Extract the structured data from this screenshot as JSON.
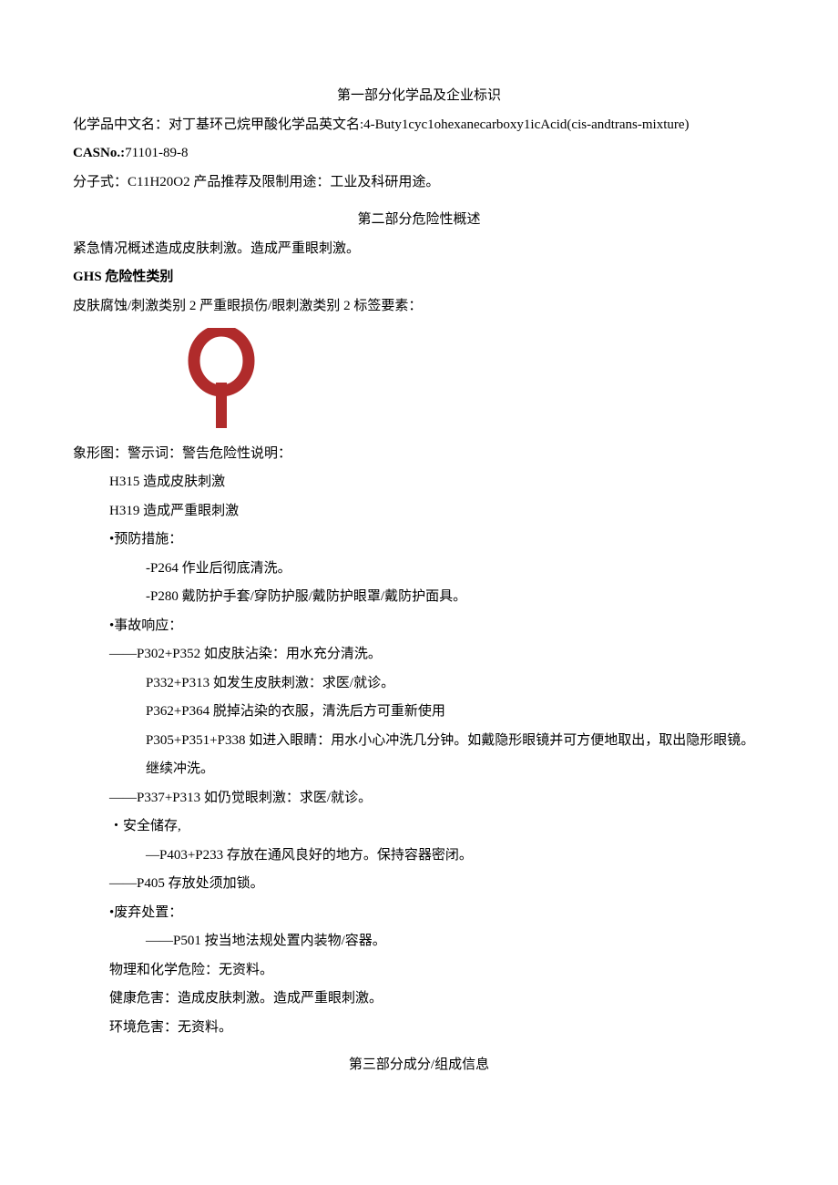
{
  "section1": {
    "title": "第一部分化学品及企业标识",
    "name_line": "化学品中文名：对丁基环己烷甲酸化学品英文名:4-Buty1cyc1ohexanecarboxy1icAcid(cis-andtrans-mixture)",
    "cas_label": "CASNo.:",
    "cas_value": "71101-89-8",
    "formula_line": "分子式：C11H20O2 产品推荐及限制用途：工业及科研用途。"
  },
  "section2": {
    "title": "第二部分危险性概述",
    "emergency": "紧急情况概述造成皮肤刺激。造成严重眼刺激。",
    "ghs_label": "GHS 危险性类别",
    "ghs_cat": "皮肤腐蚀/刺激类别 2 严重眼损伤/眼刺激类别 2 标签要素：",
    "picto_line": "象形图：警示词：警告危险性说明：",
    "h315": "H315 造成皮肤刺激",
    "h319": "H319 造成严重眼刺激",
    "precaution_label": "•预防措施：",
    "p264": "-P264 作业后彻底清洗。",
    "p280": "-P280 戴防护手套/穿防护服/戴防护眼罩/戴防护面具。",
    "response_label": "•事故响应：",
    "p302": "——P302+P352 如皮肤沾染：用水充分清洗。",
    "p332": "P332+P313 如发生皮肤刺激：求医/就诊。",
    "p362": "P362+P364 脱掉沾染的衣服，清洗后方可重新使用",
    "p305": "P305+P351+P338 如进入眼睛：用水小心冲洗几分钟。如戴隐形眼镜并可方便地取出，取出隐形眼镜。继续冲洗。",
    "p337": "——P337+P313 如仍觉眼刺激：求医/就诊。",
    "storage_label": "・安全储存,",
    "p403": "—P403+P233 存放在通风良好的地方。保持容器密闭。",
    "p405": "——P405 存放处须加锁。",
    "disposal_label": "•废弃处置：",
    "p501": "——P501 按当地法规处置内装物/容器。",
    "phys": "物理和化学危险：无资料。",
    "health": "健康危害：造成皮肤刺激。造成严重眼刺激。",
    "env": "环境危害：无资料。"
  },
  "section3": {
    "title": "第三部分成分/组成信息"
  }
}
